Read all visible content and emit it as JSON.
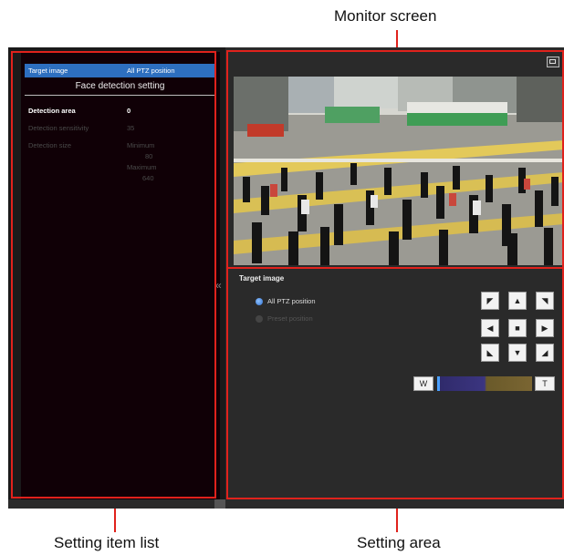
{
  "callouts": {
    "monitor_screen": "Monitor screen",
    "setting_item_list": "Setting item list",
    "setting_area": "Setting area"
  },
  "colors": {
    "callout_red": "#e0221c",
    "selected_blue": "#2d6fbf"
  },
  "setting_list": {
    "selected_row": {
      "label": "Target image",
      "value": "All PTZ position"
    },
    "section_title": "Face detection setting",
    "params": {
      "detection_area": {
        "label": "Detection area",
        "value": "0"
      },
      "detection_sensitivity": {
        "label": "Detection sensitivity",
        "value": "35"
      },
      "detection_size": {
        "label": "Detection size",
        "minimum_label": "Minimum",
        "minimum_value": "80",
        "maximum_label": "Maximum",
        "maximum_value": "640"
      }
    }
  },
  "setting_area": {
    "title": "Target image",
    "options": [
      {
        "label": "All PTZ position",
        "selected": true
      },
      {
        "label": "Preset position",
        "selected": false
      }
    ],
    "ptz_icons": [
      "up-left",
      "up",
      "up-right",
      "left",
      "home",
      "right",
      "down-left",
      "down",
      "down-right"
    ],
    "zoom": {
      "wide_label": "W",
      "tele_label": "T",
      "level": 0.0
    }
  },
  "icons": {
    "collapse": "«"
  }
}
